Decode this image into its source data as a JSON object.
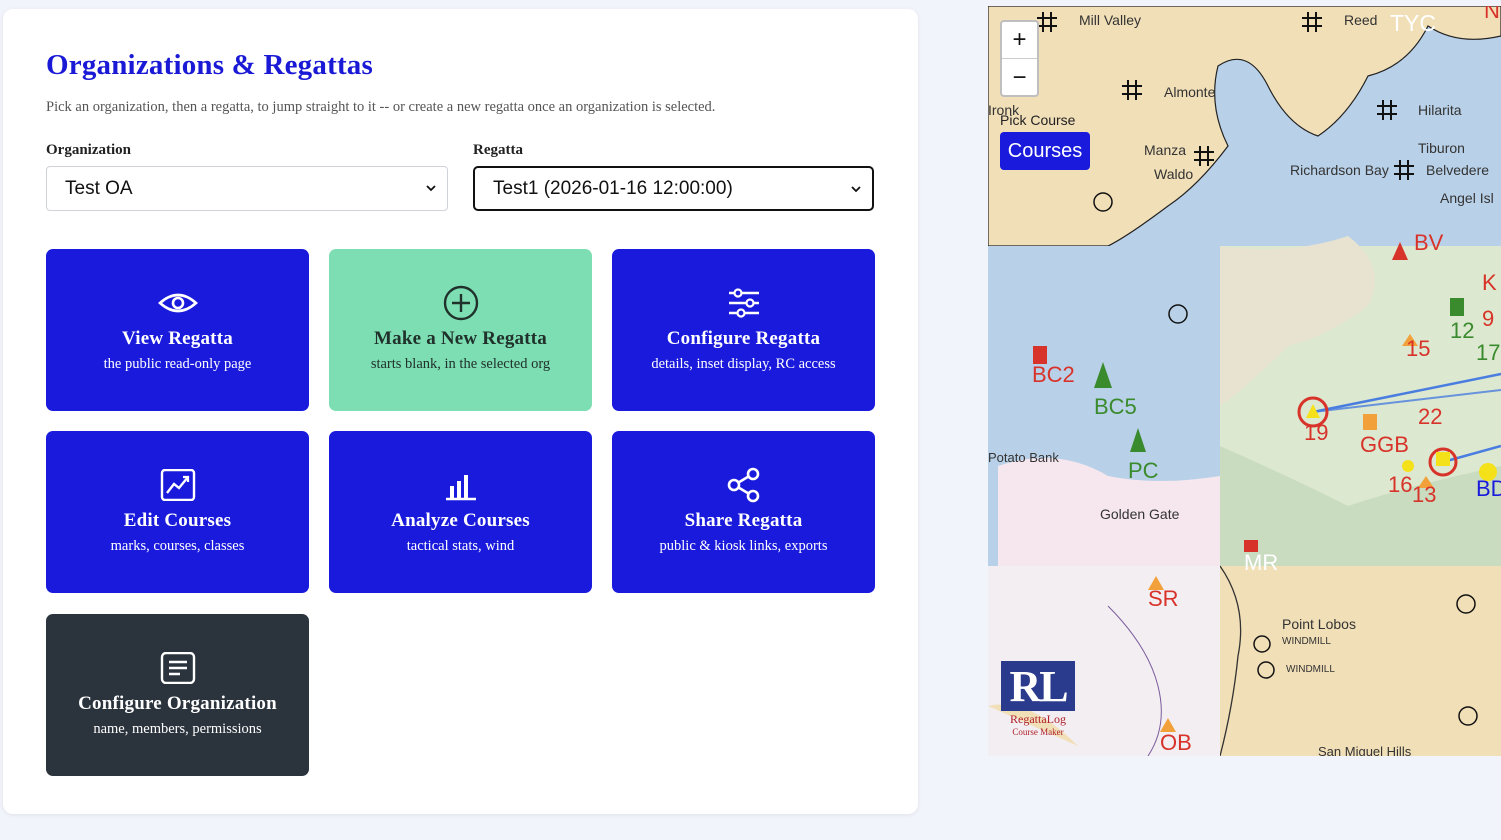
{
  "page": {
    "title": "Organizations & Regattas",
    "subtitle": "Pick an organization, then a regatta, to jump straight to it -- or create a new regatta once an organization is selected."
  },
  "organization": {
    "label": "Organization",
    "selected": "Test OA"
  },
  "regatta": {
    "label": "Regatta",
    "selected": "Test1 (2026-01-16 12:00:00)"
  },
  "tiles": [
    {
      "name": "View Regatta",
      "desc": "the public read-only page",
      "icon": "eye-icon"
    },
    {
      "name": "Make a New Regatta",
      "desc": "starts blank, in the selected org",
      "icon": "plus-circle-icon"
    },
    {
      "name": "Configure Regatta",
      "desc": "details, inset display, RC access",
      "icon": "sliders-icon"
    },
    {
      "name": "Edit Courses",
      "desc": "marks, courses, classes",
      "icon": "chart-line-icon"
    },
    {
      "name": "Analyze Courses",
      "desc": "tactical stats, wind",
      "icon": "bar-chart-icon"
    },
    {
      "name": "Share Regatta",
      "desc": "public & kiosk links, exports",
      "icon": "share-icon"
    },
    {
      "name": "Configure Organization",
      "desc": "name, members, permissions",
      "icon": "document-icon"
    }
  ],
  "map": {
    "zoom_in": "+",
    "zoom_out": "−",
    "pick_label": "Pick Course",
    "courses_button": "Courses",
    "logo_mark": "RL",
    "logo_name": "RegattaLog",
    "logo_sub": "Course Maker",
    "places": [
      "Mill Valley",
      "Reed",
      "Almonte",
      "Hilarita",
      "Tiburon",
      "Belvedere",
      "Angel Isl",
      "Manza",
      "Waldo",
      "Richardson Bay",
      "Golden Gate",
      "Point Lobos",
      "WINDMILL",
      "WINDMILL",
      "San Miguel Hills",
      "Ironk",
      "Potato Bank"
    ],
    "marks": [
      "TYC",
      "BV",
      "BC2",
      "BC5",
      "PC",
      "19",
      "GGB",
      "22",
      "15",
      "12",
      "17",
      "9",
      "K",
      "16",
      "13",
      "BD",
      "MR",
      "SR",
      "OB",
      "NR"
    ]
  },
  "colors": {
    "accent": "#1a1adc",
    "title": "#1a1ad6",
    "green_tile": "#7ddeb4",
    "dark_tile": "#2b333d",
    "mark_red": "#d8332a",
    "mark_green": "#3a8a2e"
  }
}
